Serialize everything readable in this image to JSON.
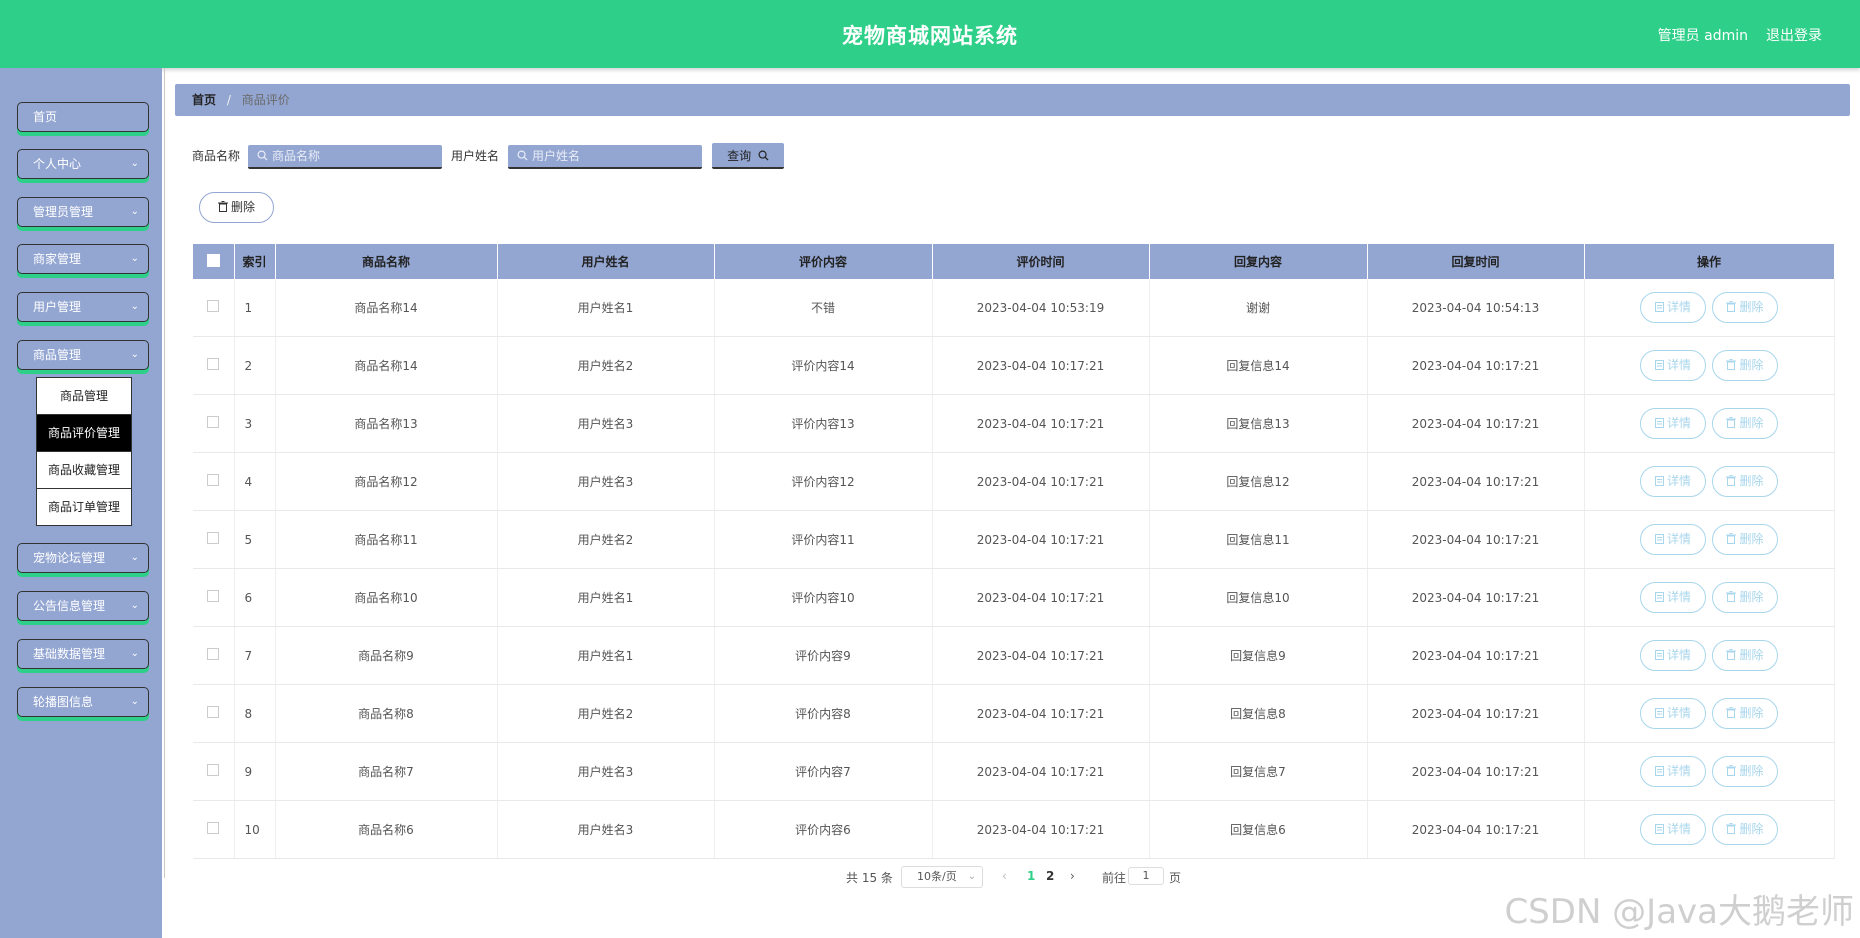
{
  "header": {
    "title": "宠物商城网站系统",
    "user": "管理员 admin",
    "logout": "退出登录"
  },
  "sidebar": {
    "items": [
      {
        "label": "首页"
      },
      {
        "label": "个人中心"
      },
      {
        "label": "管理员管理"
      },
      {
        "label": "商家管理"
      },
      {
        "label": "用户管理"
      },
      {
        "label": "商品管理"
      },
      {
        "label": "宠物论坛管理"
      },
      {
        "label": "公告信息管理"
      },
      {
        "label": "基础数据管理"
      },
      {
        "label": "轮播图信息"
      }
    ],
    "submenu": [
      {
        "label": "商品管理"
      },
      {
        "label": "商品评价管理"
      },
      {
        "label": "商品收藏管理"
      },
      {
        "label": "商品订单管理"
      }
    ],
    "active_submenu": "商品评价管理"
  },
  "breadcrumb": {
    "home": "首页",
    "separator": "/",
    "current": "商品评价"
  },
  "search": {
    "product_label": "商品名称",
    "product_placeholder": "商品名称",
    "user_label": "用户姓名",
    "user_placeholder": "用户姓名",
    "query_label": "查询"
  },
  "toolbar": {
    "delete_label": "删除"
  },
  "table": {
    "columns": [
      "索引",
      "商品名称",
      "用户姓名",
      "评价内容",
      "评价时间",
      "回复内容",
      "回复时间",
      "操作"
    ],
    "actions": {
      "detail": "详情",
      "delete": "删除"
    },
    "rows": [
      {
        "index": "1",
        "product": "商品名称14",
        "user": "用户姓名1",
        "content": "不错",
        "time": "2023-04-04 10:53:19",
        "reply": "谢谢",
        "reply_time": "2023-04-04 10:54:13"
      },
      {
        "index": "2",
        "product": "商品名称14",
        "user": "用户姓名2",
        "content": "评价内容14",
        "time": "2023-04-04 10:17:21",
        "reply": "回复信息14",
        "reply_time": "2023-04-04 10:17:21"
      },
      {
        "index": "3",
        "product": "商品名称13",
        "user": "用户姓名3",
        "content": "评价内容13",
        "time": "2023-04-04 10:17:21",
        "reply": "回复信息13",
        "reply_time": "2023-04-04 10:17:21"
      },
      {
        "index": "4",
        "product": "商品名称12",
        "user": "用户姓名3",
        "content": "评价内容12",
        "time": "2023-04-04 10:17:21",
        "reply": "回复信息12",
        "reply_time": "2023-04-04 10:17:21"
      },
      {
        "index": "5",
        "product": "商品名称11",
        "user": "用户姓名2",
        "content": "评价内容11",
        "time": "2023-04-04 10:17:21",
        "reply": "回复信息11",
        "reply_time": "2023-04-04 10:17:21"
      },
      {
        "index": "6",
        "product": "商品名称10",
        "user": "用户姓名1",
        "content": "评价内容10",
        "time": "2023-04-04 10:17:21",
        "reply": "回复信息10",
        "reply_time": "2023-04-04 10:17:21"
      },
      {
        "index": "7",
        "product": "商品名称9",
        "user": "用户姓名1",
        "content": "评价内容9",
        "time": "2023-04-04 10:17:21",
        "reply": "回复信息9",
        "reply_time": "2023-04-04 10:17:21"
      },
      {
        "index": "8",
        "product": "商品名称8",
        "user": "用户姓名2",
        "content": "评价内容8",
        "time": "2023-04-04 10:17:21",
        "reply": "回复信息8",
        "reply_time": "2023-04-04 10:17:21"
      },
      {
        "index": "9",
        "product": "商品名称7",
        "user": "用户姓名3",
        "content": "评价内容7",
        "time": "2023-04-04 10:17:21",
        "reply": "回复信息7",
        "reply_time": "2023-04-04 10:17:21"
      },
      {
        "index": "10",
        "product": "商品名称6",
        "user": "用户姓名3",
        "content": "评价内容6",
        "time": "2023-04-04 10:17:21",
        "reply": "回复信息6",
        "reply_time": "2023-04-04 10:17:21"
      }
    ]
  },
  "pagination": {
    "total": "共 15 条",
    "page_size": "10条/页",
    "pages": [
      "1",
      "2"
    ],
    "current_page": "1",
    "goto_prefix": "前往",
    "goto_value": "1",
    "goto_suffix": "页"
  },
  "watermark": "CSDN @Java大鹅老师",
  "colors": {
    "header": "#2ecf88",
    "accent": "#93a6d2",
    "action_button": "#a8d6ec"
  }
}
